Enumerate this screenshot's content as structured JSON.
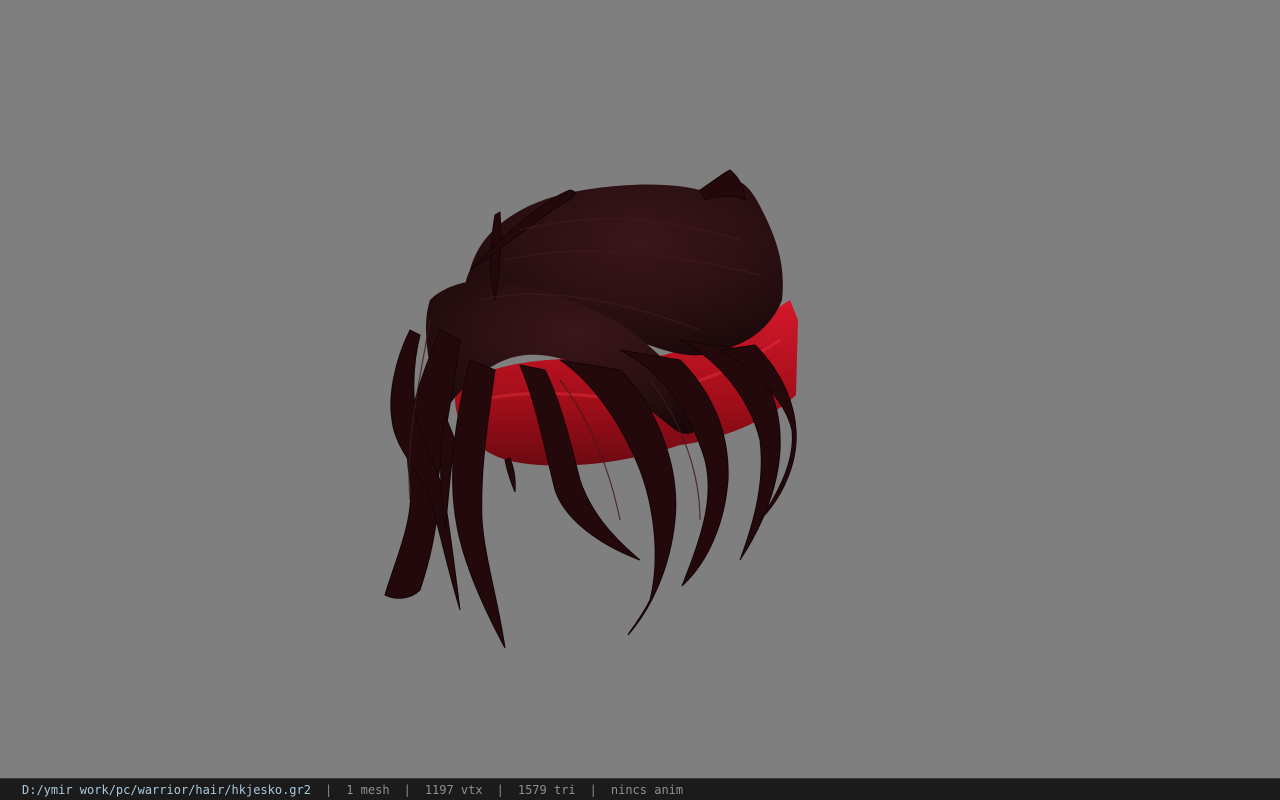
{
  "viewer": {
    "background_color": "#7f7f7f",
    "model_name": "hkjesko.gr2",
    "hair_color": "#2a0f12",
    "band_color": "#b0101c"
  },
  "statusbar": {
    "file_path": "D:/ymir work/pc/warrior/hair/hkjesko.gr2",
    "separator": "|",
    "mesh_count": "1 mesh",
    "vertex_count": "1197 vtx",
    "triangle_count": "1579 tri",
    "anim_status": "nincs anim"
  }
}
